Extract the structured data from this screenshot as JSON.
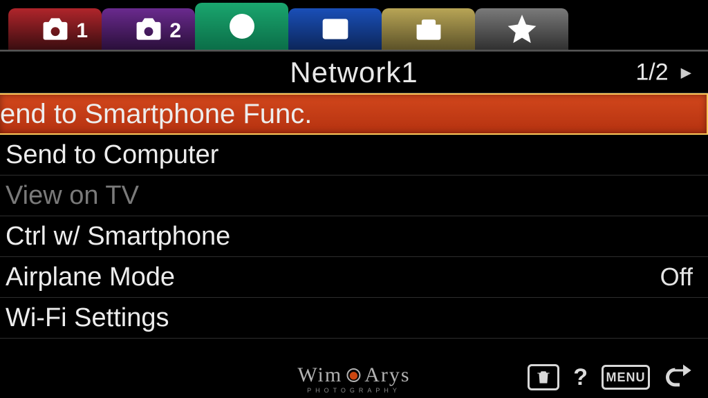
{
  "tabs": [
    {
      "name": "camera-1-tab",
      "badge": "1",
      "color": "red",
      "icon": "camera"
    },
    {
      "name": "camera-2-tab",
      "badge": "2",
      "color": "purple",
      "icon": "camera"
    },
    {
      "name": "network-tab",
      "badge": "",
      "color": "green",
      "icon": "globe",
      "active": true
    },
    {
      "name": "playback-tab",
      "badge": "",
      "color": "blue",
      "icon": "play"
    },
    {
      "name": "setup-tab",
      "badge": "",
      "color": "yellow",
      "icon": "toolbox"
    },
    {
      "name": "my-menu-tab",
      "badge": "",
      "color": "grey",
      "icon": "star"
    }
  ],
  "header": {
    "title": "Network1",
    "page": "1/2"
  },
  "menu": {
    "items": [
      {
        "label": "end to Smartphone Func.",
        "value": "",
        "selected": true,
        "disabled": false
      },
      {
        "label": "Send to Computer",
        "value": "",
        "selected": false,
        "disabled": false
      },
      {
        "label": "View on TV",
        "value": "",
        "selected": false,
        "disabled": true
      },
      {
        "label": "Ctrl w/ Smartphone",
        "value": "",
        "selected": false,
        "disabled": false
      },
      {
        "label": "Airplane Mode",
        "value": "Off",
        "selected": false,
        "disabled": false
      },
      {
        "label": "Wi-Fi Settings",
        "value": "",
        "selected": false,
        "disabled": false
      }
    ]
  },
  "footer": {
    "menu_label": "MENU",
    "help_label": "?"
  },
  "watermark": {
    "text": "Wim Arys",
    "sub": "PHOTOGRAPHY"
  }
}
